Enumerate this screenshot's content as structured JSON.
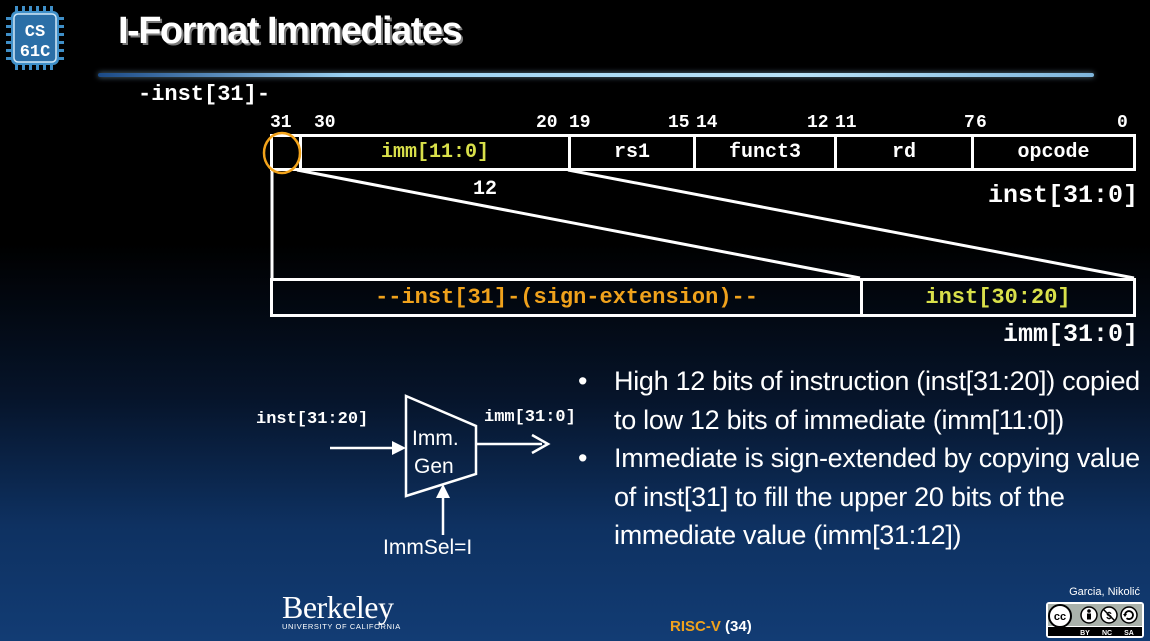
{
  "slide": {
    "title": "I-Format Immediates",
    "logo_line1": "CS",
    "logo_line2": "61C"
  },
  "instruction": {
    "sign_bit_label": "-inst[31]-",
    "bit_numbers": [
      "31",
      "30",
      "20",
      "19",
      "15",
      "14",
      "12",
      "11",
      "7",
      "6",
      "0"
    ],
    "fields": [
      "imm[11:0]",
      "rs1",
      "funct3",
      "rd",
      "opcode"
    ],
    "width_label": "12",
    "name": "inst[31:0]"
  },
  "immediate": {
    "extension_field": "--inst[31]-(sign-extension)--",
    "low_field": "inst[30:20]",
    "name": "imm[31:0]"
  },
  "immgen": {
    "input_label": "inst[31:20]",
    "output_label": "imm[31:0]",
    "block_line1": "Imm.",
    "block_line2": "Gen",
    "select_label": "ImmSel=I"
  },
  "bullets": [
    "High 12 bits of instruction (inst[31:20]) copied to low 12 bits of immediate (imm[11:0])",
    "Immediate is sign-extended by copying value of inst[31] to fill the upper 20 bits of the immediate value (imm[31:12])"
  ],
  "footer": {
    "institution": "Berkeley",
    "institution_sub": "UNIVERSITY OF CALIFORNIA",
    "topic": "RISC-V",
    "page": "(34)",
    "authors": "Garcia, Nikolić",
    "license_tags": [
      "BY",
      "NC",
      "SA"
    ],
    "license_mark": "cc"
  },
  "colors": {
    "field_yellow": "#d9e04a",
    "extension_orange": "#f0a21c",
    "highlight_circle": "#f2a31b",
    "title_rule": "#9bd2f2"
  }
}
